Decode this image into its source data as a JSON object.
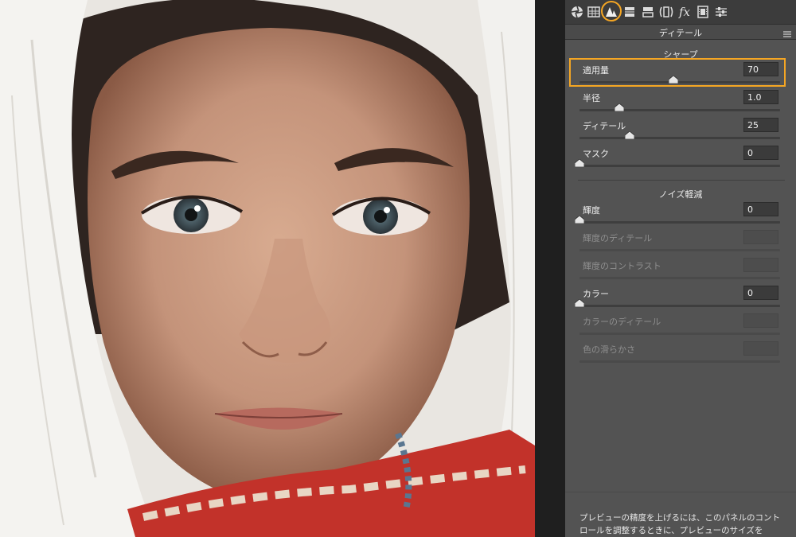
{
  "tabs": [
    {
      "name": "basic-tab",
      "icon": "aperture-icon"
    },
    {
      "name": "tone-curve-tab",
      "icon": "grid-curve-icon"
    },
    {
      "name": "detail-tab",
      "icon": "mountain-triangle-icon",
      "active": true
    },
    {
      "name": "hsl-tab",
      "icon": "hsl-bars-icon"
    },
    {
      "name": "split-toning-tab",
      "icon": "split-toning-icon"
    },
    {
      "name": "lens-corrections-tab",
      "icon": "lens-icon"
    },
    {
      "name": "effects-tab",
      "icon": "fx-icon",
      "label": "fx"
    },
    {
      "name": "camera-calibration-tab",
      "icon": "film-icon"
    },
    {
      "name": "presets-tab",
      "icon": "sliders-icon"
    }
  ],
  "panel": {
    "title": "ディテール",
    "menu_icon": "panel-menu-icon"
  },
  "sharpen": {
    "title": "シャープ",
    "controls": [
      {
        "label": "適用量",
        "value": "70",
        "level": 0.47,
        "enabled": true,
        "highlighted": true
      },
      {
        "label": "半径",
        "value": "1.0",
        "level": 0.2,
        "enabled": true
      },
      {
        "label": "ディテール",
        "value": "25",
        "level": 0.25,
        "enabled": true
      },
      {
        "label": "マスク",
        "value": "0",
        "level": 0.0,
        "enabled": true
      }
    ]
  },
  "noise": {
    "title": "ノイズ軽減",
    "controls": [
      {
        "label": "輝度",
        "value": "0",
        "level": 0.0,
        "enabled": true,
        "has_slider": true
      },
      {
        "label": "輝度のディテール",
        "value": "",
        "enabled": false,
        "has_slider": true
      },
      {
        "label": "輝度のコントラスト",
        "value": "",
        "enabled": false,
        "has_slider": true
      },
      {
        "label": "カラー",
        "value": "0",
        "level": 0.0,
        "enabled": true,
        "has_slider": true
      },
      {
        "label": "カラーのディテール",
        "value": "",
        "enabled": false,
        "has_slider": true
      },
      {
        "label": "色の滑らかさ",
        "value": "",
        "enabled": false,
        "has_slider": true
      }
    ]
  },
  "footer": {
    "line1": "プレビューの精度を上げるには、このパネルのコント",
    "line2": "ロールを調整するときに、プレビューのサイズを"
  },
  "colors": {
    "highlight": "#f5a623",
    "panel_bg": "#535353",
    "tabbar_bg": "#3c3c3c"
  }
}
